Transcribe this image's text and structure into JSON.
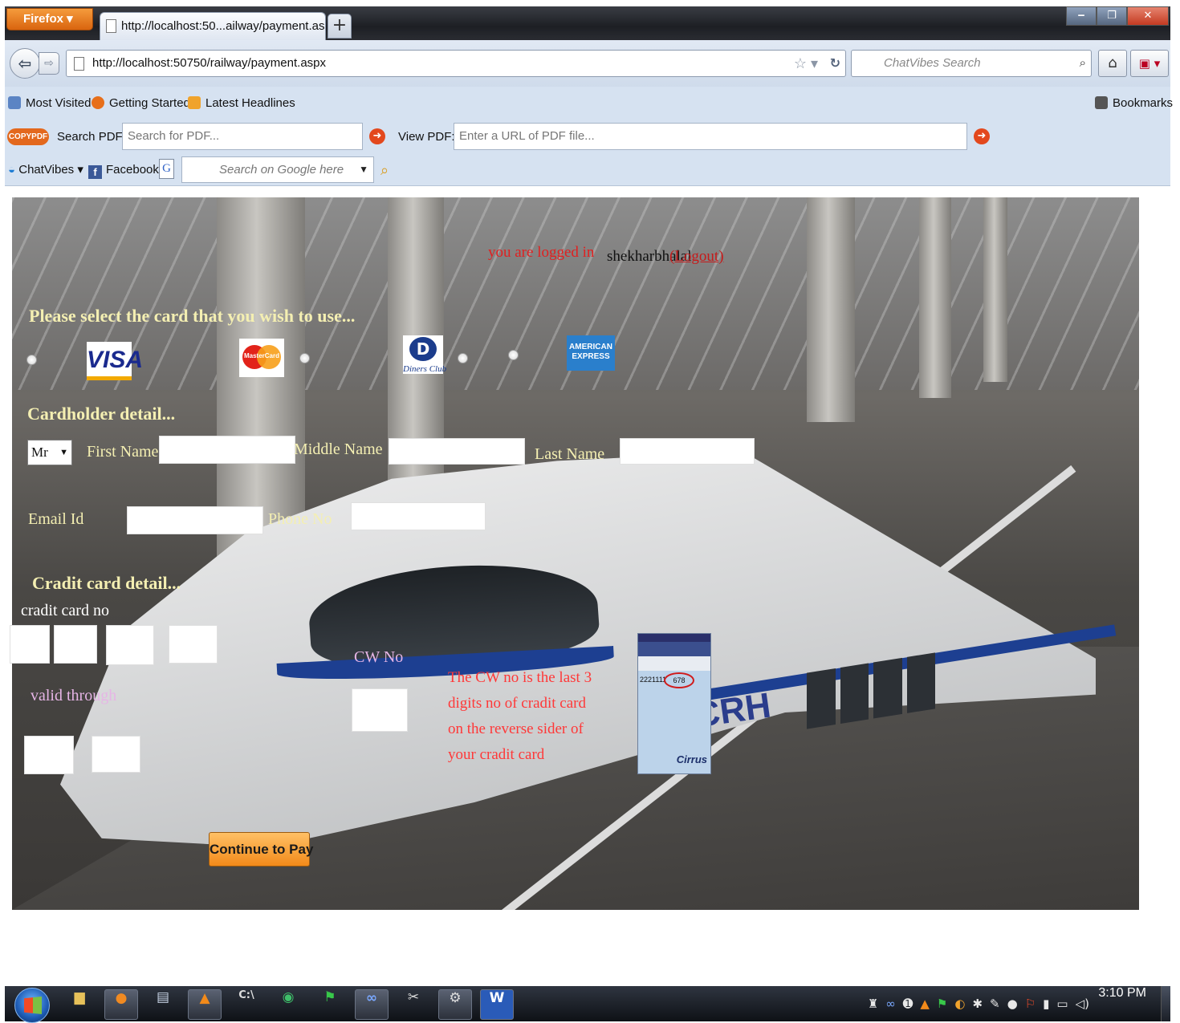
{
  "browser": {
    "menu_button": "Firefox",
    "tab_title": "http://localhost:50...ailway/payment.aspx",
    "new_tab": "+",
    "url": "http://localhost:50750/railway/payment.aspx",
    "search_placeholder": "ChatVibes Search",
    "bookmarks": [
      "Most Visited",
      "Getting Started",
      "Latest Headlines"
    ],
    "bookmarks_menu": "Bookmarks",
    "pdf_toolbar": {
      "logo": "COPYPDF",
      "search_label": "Search PDF:",
      "search_placeholder": "Search for PDF...",
      "view_label": "View PDF:",
      "view_placeholder": "Enter a URL of PDF file..."
    },
    "chat_toolbar": {
      "chatvibes": "ChatVibes",
      "facebook": "Facebook",
      "google_icon": "G",
      "google_placeholder": "Search on Google here"
    }
  },
  "page": {
    "logged_in_text": "you are logged in",
    "username": "shekharbhalal",
    "logout": "(Logout)",
    "card_prompt": "Please select the card that you wish to use...",
    "cards": {
      "visa": "VISA",
      "mastercard": "MasterCard",
      "diners_letter": "D",
      "diners": "Diners Club",
      "amex_line1": "AMERICAN",
      "amex_line2": "EXPRESS"
    },
    "cardholder_heading": "Cardholder detail...",
    "title_select": "Mr",
    "first_name_label": "First Name",
    "middle_name_label": "Middle Name",
    "last_name_label": "Last Name",
    "email_label": "Email Id",
    "phone_label": "Phone No",
    "credit_heading": "Cradit card detail...",
    "card_no_label": "cradit card no",
    "valid_label": "valid through",
    "cvv_label": "CW No",
    "cvv_note": "The CW no is the last 3 digits no of cradit card on the reverse sider of your cradit card",
    "cvv_image": {
      "digits_left": "2221111",
      "digits_circled": "678",
      "brand": "Cirrus"
    },
    "continue_button": "Continue to Pay",
    "background_text": "CRH"
  },
  "taskbar": {
    "clock": "3:10 PM"
  },
  "colors": {
    "heading_yellow": "#f4efb2",
    "logged_red": "#e02020",
    "cvv_note_red": "#ff3838",
    "button_orange": "#f28a1a"
  }
}
